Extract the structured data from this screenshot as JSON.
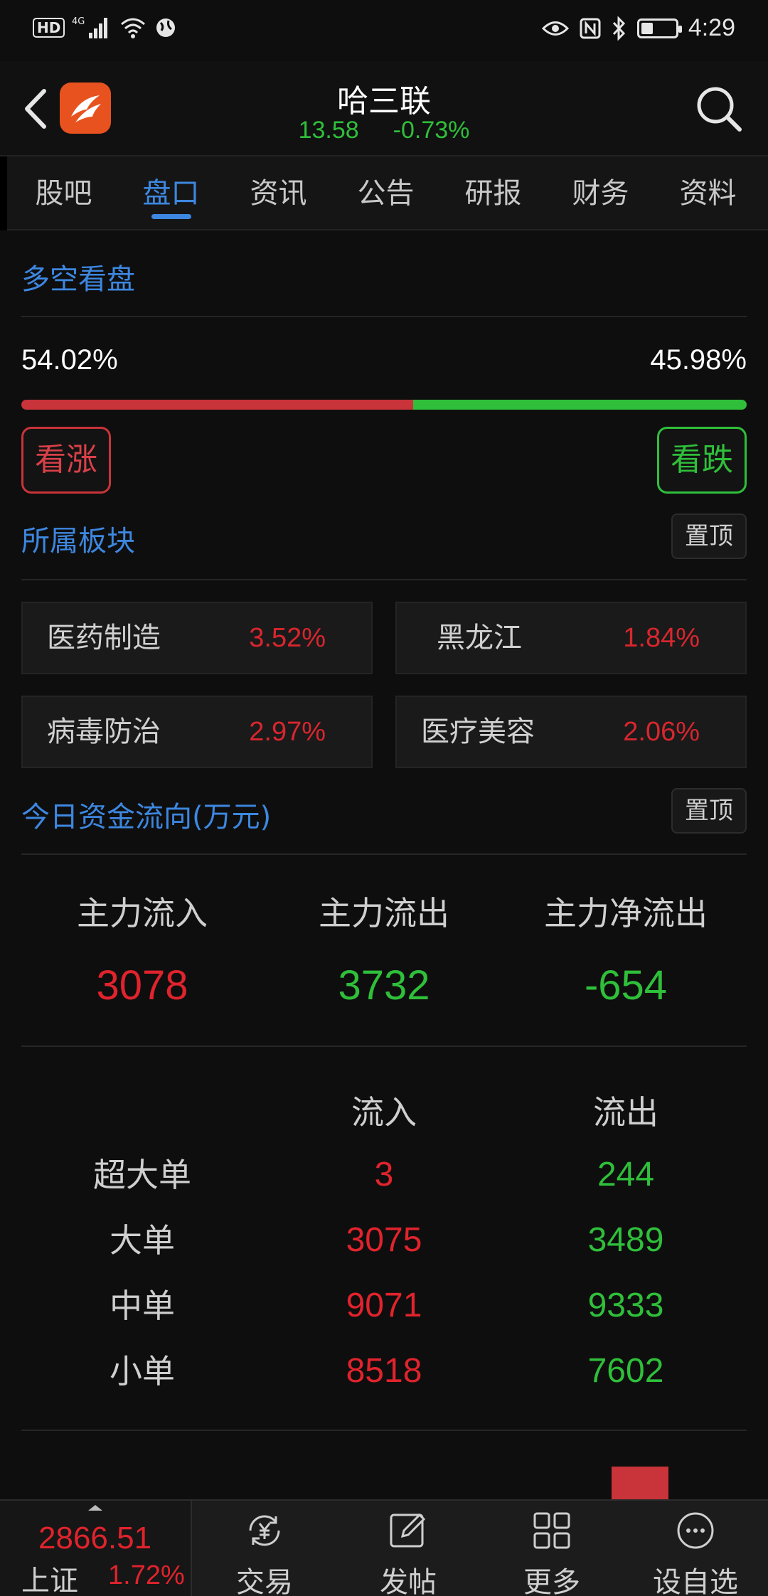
{
  "status_bar": {
    "hd": "HD",
    "network": "4G",
    "time": "4:29"
  },
  "header": {
    "title": "哈三联",
    "price": "13.58",
    "change": "-0.73%"
  },
  "tabs": [
    "股吧",
    "盘口",
    "资讯",
    "公告",
    "研报",
    "财务",
    "资料"
  ],
  "active_tab": "盘口",
  "sentiment": {
    "title": "多空看盘",
    "bull_pct": "54.02%",
    "bear_pct": "45.98%",
    "bull_ratio": 0.5402,
    "bull_button": "看涨",
    "bear_button": "看跌"
  },
  "sectors": {
    "title": "所属板块",
    "pin_label": "置顶",
    "items": [
      {
        "name": "医药制造",
        "change": "3.52%"
      },
      {
        "name": "黑龙江",
        "change": "1.84%"
      },
      {
        "name": "病毒防治",
        "change": "2.97%"
      },
      {
        "name": "医疗美容",
        "change": "2.06%"
      }
    ]
  },
  "fund_flow": {
    "title": "今日资金流向(万元)",
    "pin_label": "置顶",
    "summary": [
      {
        "label": "主力流入",
        "value": "3078"
      },
      {
        "label": "主力流出",
        "value": "3732"
      },
      {
        "label": "主力净流出",
        "value": "-654"
      }
    ],
    "columns": [
      "流入",
      "流出"
    ],
    "rows": [
      {
        "label": "超大单",
        "in": "3",
        "out": "244"
      },
      {
        "label": "大单",
        "in": "3075",
        "out": "3489"
      },
      {
        "label": "中单",
        "in": "9071",
        "out": "9333"
      },
      {
        "label": "小单",
        "in": "8518",
        "out": "7602"
      }
    ]
  },
  "bottom_bar": {
    "index_value": "2866.51",
    "index_name": "上证",
    "index_change": "1.72%",
    "nav": [
      "交易",
      "发帖",
      "更多",
      "设自选"
    ]
  },
  "colors": {
    "accent": "#3d87e0",
    "up": "#e0232c",
    "down": "#2fbf3a",
    "background": "#0e0e0e"
  }
}
